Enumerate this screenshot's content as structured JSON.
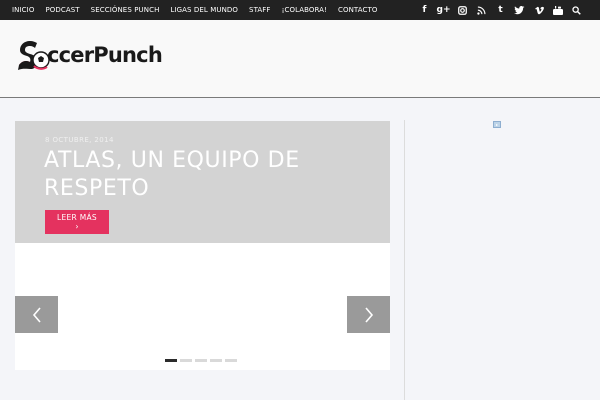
{
  "nav": {
    "items": [
      "INICIO",
      "PODCAST",
      "SECCIÓNES PUNCH",
      "LIGAS DEL MUNDO",
      "STAFF",
      "¡COLABORA!",
      "CONTACTO"
    ]
  },
  "social": {
    "facebook_glyph": "f",
    "googleplus_glyph": "g+",
    "tumblr_glyph": "t"
  },
  "logo": {
    "text": "ccerPunch"
  },
  "slider": {
    "date": "8 OCTUBRE, 2014",
    "headline": "ATLAS, UN EQUIPO DE RESPETO",
    "read_more_label": "LEER MÁS",
    "read_more_arrow": "›",
    "slide_count": 5,
    "active_slide": 1
  },
  "colors": {
    "accent": "#e4325f",
    "topbar": "#222222",
    "caption_bg": "#d3d3d3",
    "arrow_bg": "#9a9a9a"
  }
}
